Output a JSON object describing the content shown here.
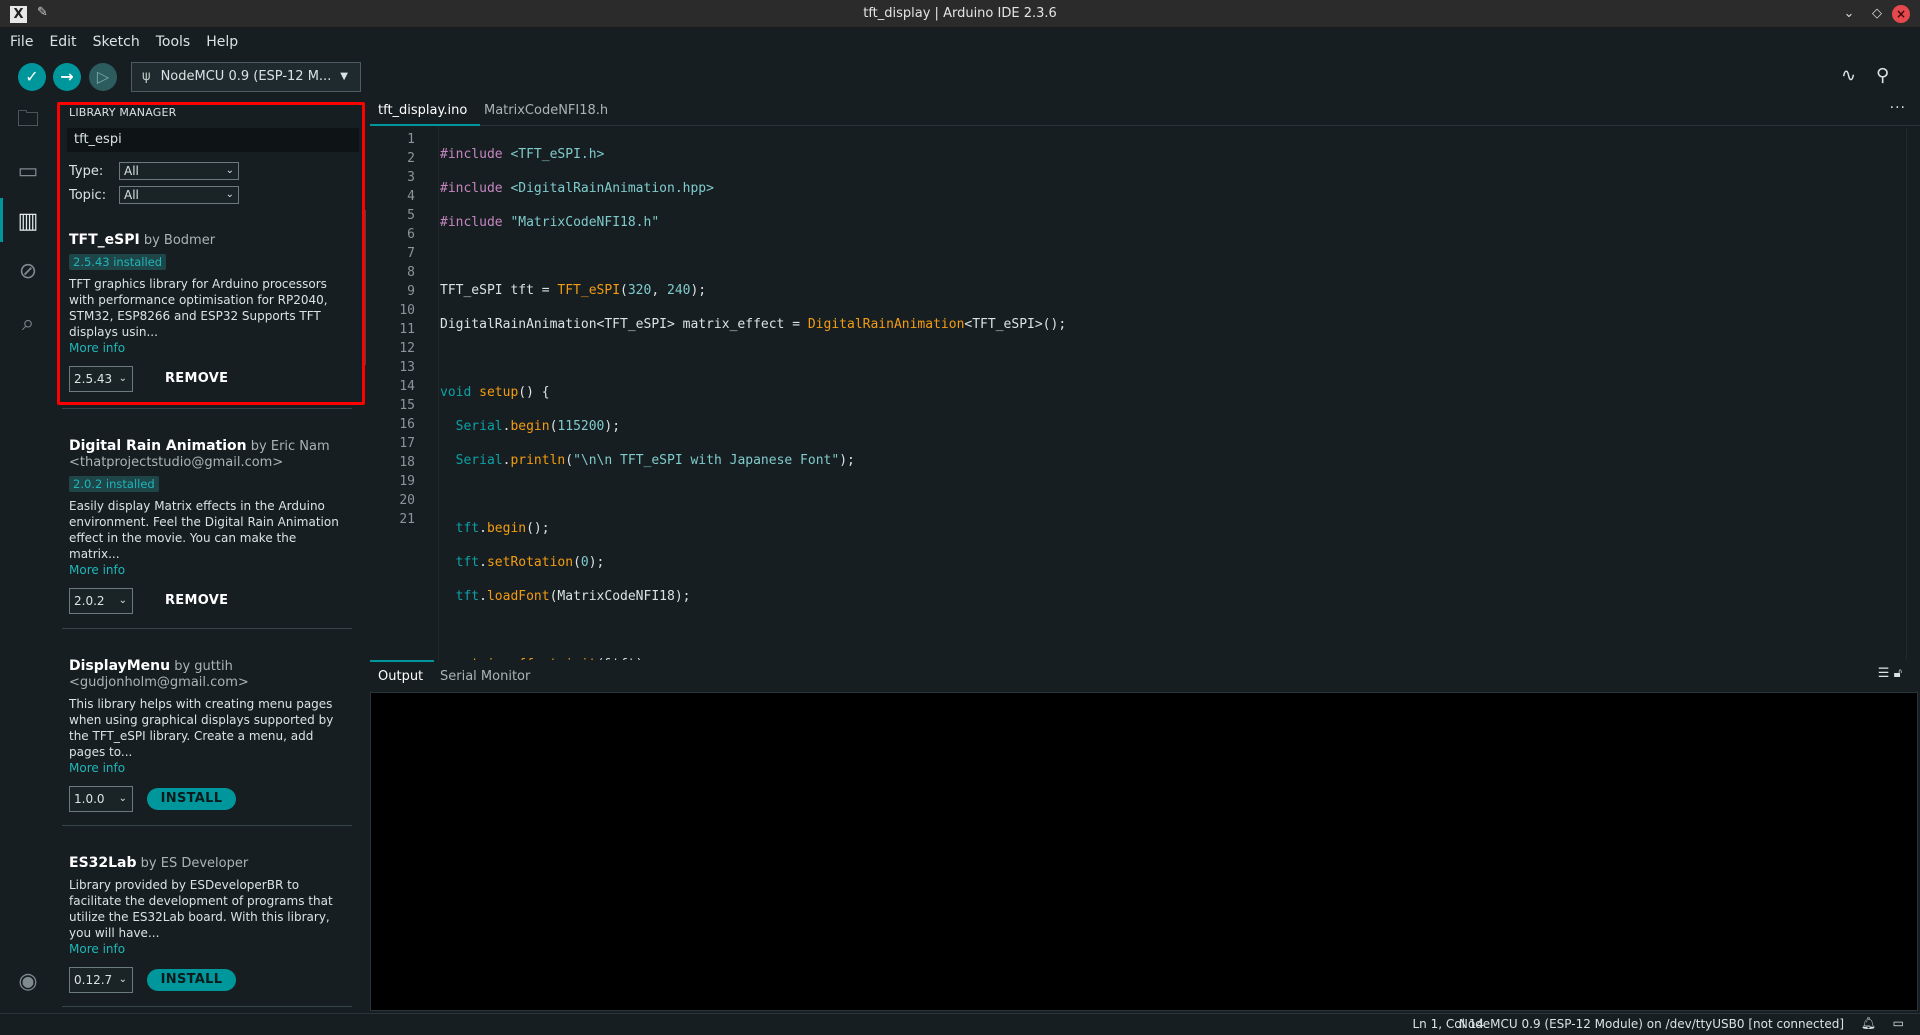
{
  "window": {
    "title": "tft_display | Arduino IDE 2.3.6"
  },
  "menu": [
    "File",
    "Edit",
    "Sketch",
    "Tools",
    "Help"
  ],
  "toolbar": {
    "board": "NodeMCU 0.9 (ESP-12 M...",
    "verify_icon": "check-icon",
    "upload_icon": "arrow-right-icon",
    "debug_icon": "debug-icon"
  },
  "library_manager": {
    "title": "LIBRARY MANAGER",
    "search_value": "tft_espi",
    "type_label": "Type:",
    "type_value": "All",
    "topic_label": "Topic:",
    "topic_value": "All",
    "items": [
      {
        "name": "TFT_eSPI",
        "by": "by Bodmer",
        "extra": "",
        "installed": "2.5.43 installed",
        "desc": "TFT graphics library for Arduino processors with performance optimisation for RP2040, STM32, ESP8266 and ESP32 Supports TFT displays usin...",
        "more": "More info",
        "version": "2.5.43",
        "action": "REMOVE"
      },
      {
        "name": "Digital Rain Animation",
        "by": "by Eric Nam",
        "extra": "<thatprojectstudio@gmail.com>",
        "installed": "2.0.2 installed",
        "desc": "Easily display Matrix effects in the Arduino environment. Feel the Digital Rain Animation effect in the movie. You can make the matrix...",
        "more": "More info",
        "version": "2.0.2",
        "action": "REMOVE"
      },
      {
        "name": "DisplayMenu",
        "by": "by guttih",
        "extra": "<gudjonholm@gmail.com>",
        "installed": "",
        "desc": "This library helps with creating menu pages when using graphical displays supported by the TFT_eSPI library. Create a menu, add pages to...",
        "more": "More info",
        "version": "1.0.0",
        "action": "INSTALL"
      },
      {
        "name": "ES32Lab",
        "by": "by ES Developer",
        "extra": "",
        "installed": "",
        "desc": "Library provided by ESDeveloperBR to facilitate the development of programs that utilize the ES32Lab board. With this library, you will have...",
        "more": "More info",
        "version": "0.12.7",
        "action": "INSTALL"
      }
    ]
  },
  "editor": {
    "tabs": [
      "tft_display.ino",
      "MatrixCodeNFI18.h"
    ],
    "more": "···",
    "line_numbers": [
      "1",
      "2",
      "3",
      "4",
      "5",
      "6",
      "7",
      "8",
      "9",
      "10",
      "11",
      "12",
      "13",
      "14",
      "15",
      "16",
      "17",
      "18",
      "19",
      "20",
      "21"
    ]
  },
  "output": {
    "tabs": [
      "Output",
      "Serial Monitor"
    ]
  },
  "statusbar": {
    "position": "Ln 1, Col 14",
    "board": "NodeMCU 0.9 (ESP-12 Module) on /dev/ttyUSB0 [not connected]"
  }
}
